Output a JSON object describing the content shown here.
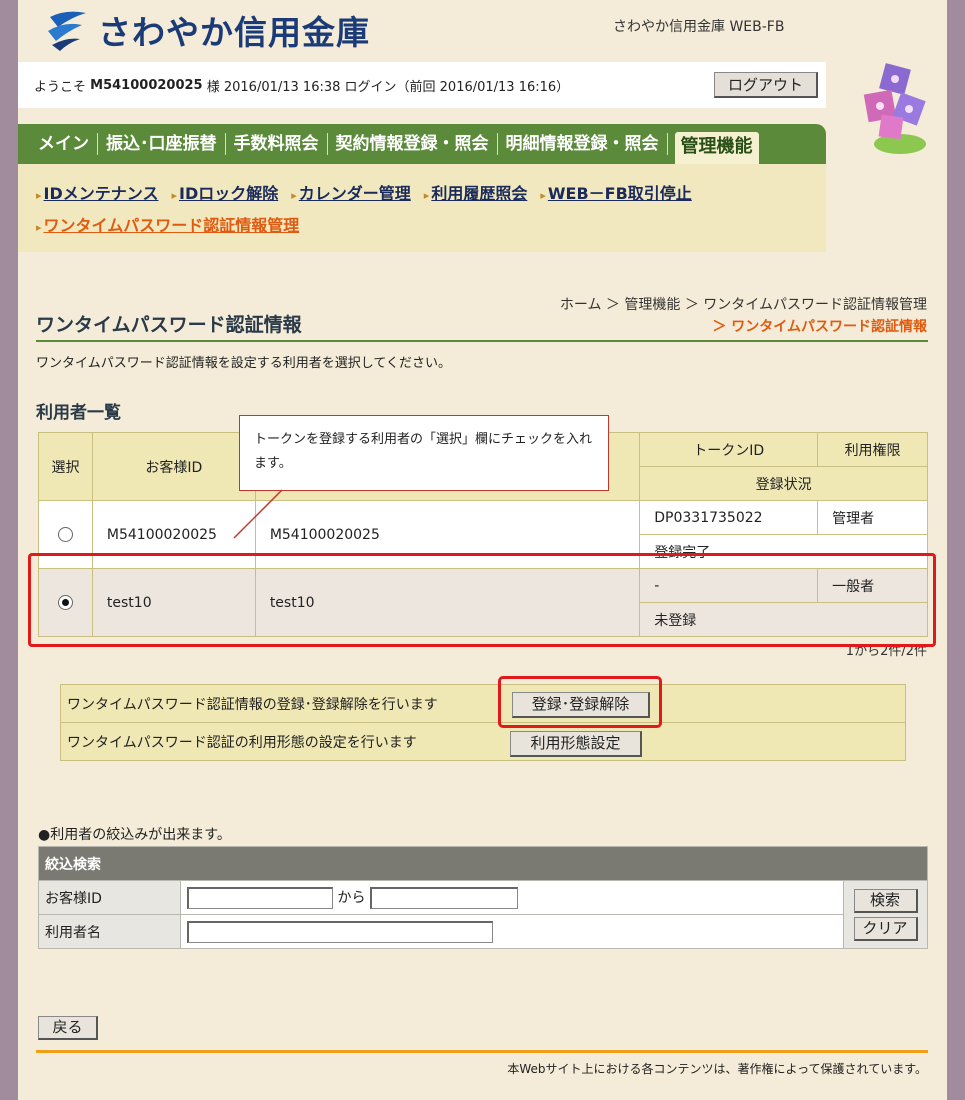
{
  "header": {
    "bank_name": "さわやか信用金庫",
    "site_label": "さわやか信用金庫 WEB-FB",
    "welcome_prefix": "ようこそ",
    "user_id": "M54100020025",
    "welcome_suffix": "様 2016/01/13 16:38 ログイン（前回 2016/01/13 16:16）",
    "logout": "ログアウト"
  },
  "tabs": [
    "メイン",
    "振込･口座振替",
    "手数料照会",
    "契約情報登録・照会",
    "明細情報登録・照会"
  ],
  "active_tab": "管理機能",
  "submenu": {
    "items": [
      "IDメンテナンス",
      "IDロック解除",
      "カレンダー管理",
      "利用履歴照会",
      "WEB－FB取引停止"
    ],
    "current": "ワンタイムパスワード認証情報管理"
  },
  "breadcrumb": {
    "line1": "ホーム ＞ 管理機能 ＞ ワンタイムパスワード認証情報管理",
    "line2": "＞ ワンタイムパスワード認証情報"
  },
  "page_title": "ワンタイムパスワード認証情報",
  "instruction": "ワンタイムパスワード認証情報を設定する利用者を選択してください。",
  "user_list": {
    "title": "利用者一覧",
    "headers": {
      "select": "選択",
      "customer_id": "お客様ID",
      "token_id": "トークンID",
      "permission": "利用権限",
      "reg_status": "登録状況"
    },
    "rows": [
      {
        "customer_id": "M54100020025",
        "user_name": "M54100020025",
        "token_id": "DP0331735022",
        "permission": "管理者",
        "status": "登録完了",
        "selected": false
      },
      {
        "customer_id": "test10",
        "user_name": "test10",
        "token_id": "-",
        "permission": "一般者",
        "status": "未登録",
        "selected": true
      }
    ],
    "count": "1から2件/2件"
  },
  "callout": "トークンを登録する利用者の「選択」欄にチェックを入れます。",
  "actions": [
    {
      "label": "ワンタイムパスワード認証情報の登録･登録解除を行います",
      "button": "登録･登録解除"
    },
    {
      "label": "ワンタイムパスワード認証の利用形態の設定を行います",
      "button": "利用形態設定"
    }
  ],
  "narrow_note": "●利用者の絞込みが出来ます。",
  "search": {
    "title": "絞込検索",
    "customer_id_label": "お客様ID",
    "range_word": "から",
    "user_name_label": "利用者名",
    "search_button": "検索",
    "clear_button": "クリア"
  },
  "back_button": "戻る",
  "copyright": "本Webサイト上における各コンテンツは、著作権によって保護されています。"
}
